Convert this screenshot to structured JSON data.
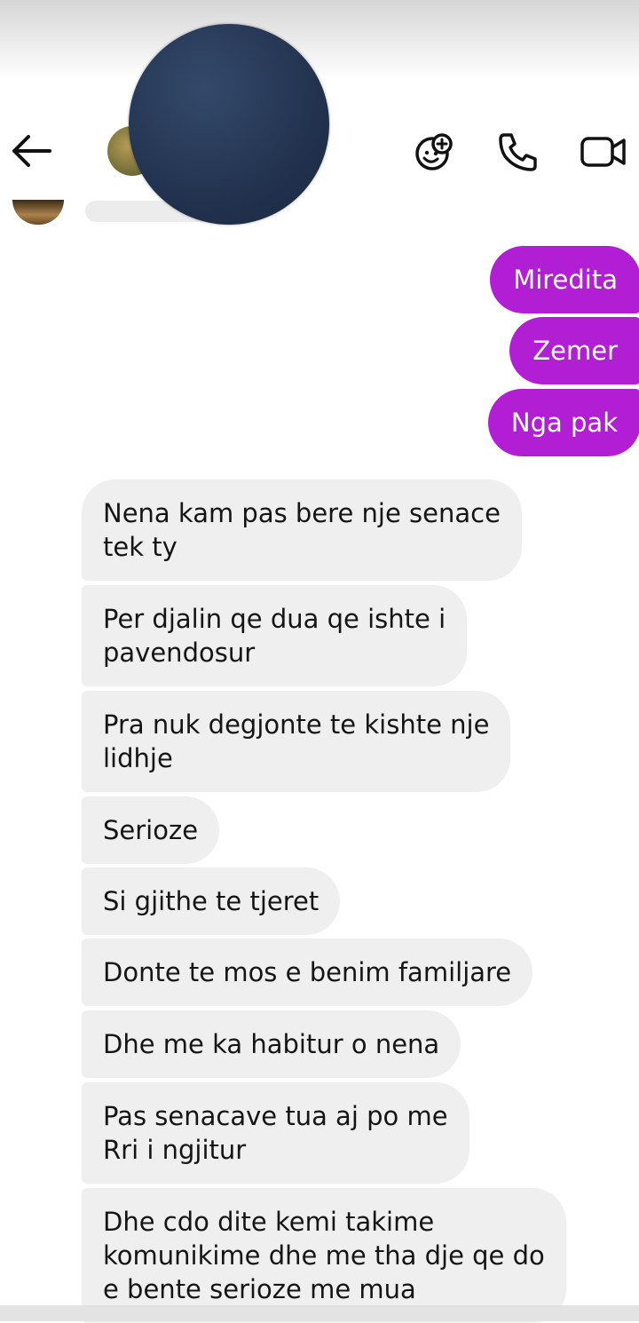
{
  "conversation": {
    "outgoing": [
      "Miredita",
      "Zemer",
      "Nga pak"
    ],
    "incoming": [
      "Nena kam pas bere nje senace\ntek ty",
      "Per djalin qe dua qe ishte i\npavendosur",
      "Pra nuk degjonte te kishte nje\nlidhje",
      "Serioze",
      "Si gjithe te tjeret",
      "Donte te mos e benim familjare",
      "Dhe me ka habitur o nena",
      "Pas senacave tua aj po me\nRri i ngjitur",
      "Dhe cdo dite kemi takime\nkomunikime dhe me tha dje qe do\ne bente serioze me mua"
    ]
  },
  "header": {
    "icons": [
      "back-arrow-icon",
      "effects-icon",
      "phone-icon",
      "video-camera-icon"
    ]
  },
  "colors": {
    "outgoing_bubble": "#b21ed3",
    "incoming_bubble": "#efefef",
    "obscuring_disc": "#22334f"
  }
}
